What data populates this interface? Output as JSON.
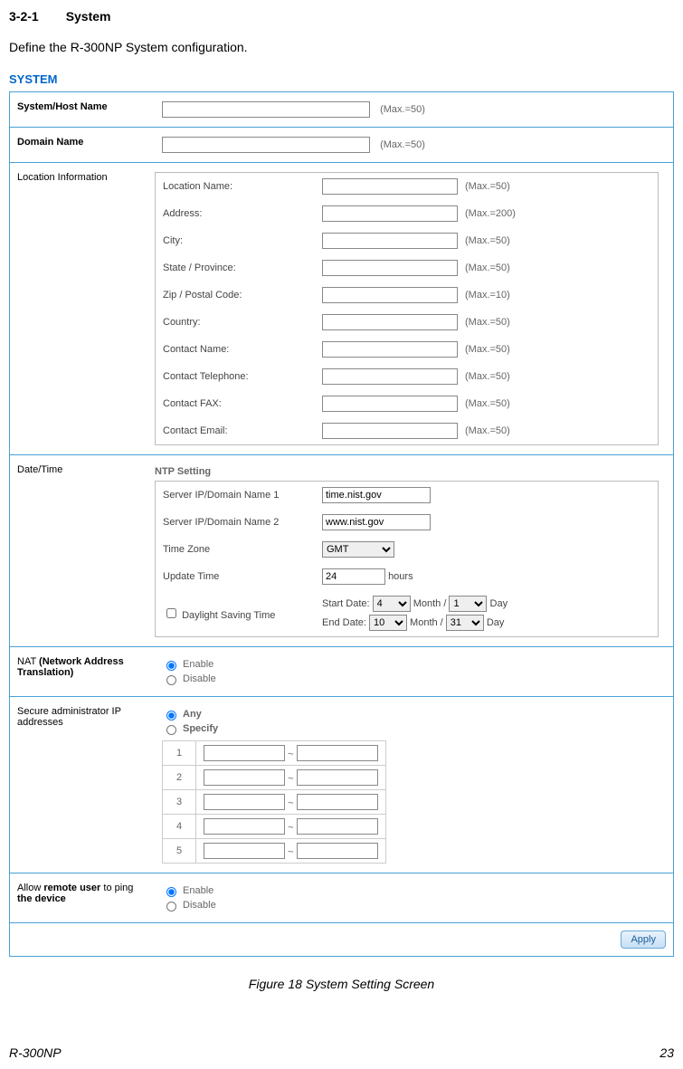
{
  "heading": {
    "section_num": "3-2-1",
    "section_title": "System"
  },
  "intro": "Define the R-300NP System configuration.",
  "panel_title": "SYSTEM",
  "rows": {
    "hostname": {
      "label": "System/Host Name",
      "hint": "(Max.=50)"
    },
    "domain": {
      "label": "Domain Name",
      "hint": "(Max.=50)"
    },
    "location_label": "Location Information",
    "location": [
      {
        "label": "Location Name:",
        "hint": "(Max.=50)"
      },
      {
        "label": "Address:",
        "hint": "(Max.=200)"
      },
      {
        "label": "City:",
        "hint": "(Max.=50)"
      },
      {
        "label": "State / Province:",
        "hint": "(Max.=50)"
      },
      {
        "label": "Zip / Postal Code:",
        "hint": "(Max.=10)"
      },
      {
        "label": "Country:",
        "hint": "(Max.=50)"
      },
      {
        "label": "Contact Name:",
        "hint": "(Max.=50)"
      },
      {
        "label": "Contact Telephone:",
        "hint": "(Max.=50)"
      },
      {
        "label": "Contact FAX:",
        "hint": "(Max.=50)"
      },
      {
        "label": "Contact Email:",
        "hint": "(Max.=50)"
      }
    ],
    "datetime_label": "Date/Time",
    "ntp_title": "NTP Setting",
    "ntp": {
      "server1_label": "Server IP/Domain Name 1",
      "server1_value": "time.nist.gov",
      "server2_label": "Server IP/Domain Name 2",
      "server2_value": "www.nist.gov",
      "tz_label": "Time Zone",
      "tz_value": "GMT",
      "update_label": "Update Time",
      "update_value": "24",
      "update_unit": "hours",
      "dst_label": "Daylight Saving Time",
      "start_label": "Start Date:",
      "end_label": "End Date:",
      "month_word": "Month /",
      "day_word": "Day",
      "start_month": "4",
      "start_day": "1",
      "end_month": "10",
      "end_day": "31"
    },
    "nat_label_a": "NAT ",
    "nat_label_b": "(Network Address Translation)",
    "nat_enable": "Enable",
    "nat_disable": "Disable",
    "secure_label": "Secure administrator IP addresses",
    "secure_any": "Any",
    "secure_specify": "Specify",
    "tilde": "~",
    "ping_label": "Allow remote user to ping the device",
    "ping_allow": "Allow ",
    "ping_remote_user": "remote user",
    "ping_to_ping": " to ping ",
    "ping_the_device": "the device",
    "ping_enable": "Enable",
    "ping_disable": "Disable",
    "apply": "Apply"
  },
  "caption": "Figure 18 System Setting Screen",
  "footer": {
    "model": "R-300NP",
    "page": "23"
  }
}
